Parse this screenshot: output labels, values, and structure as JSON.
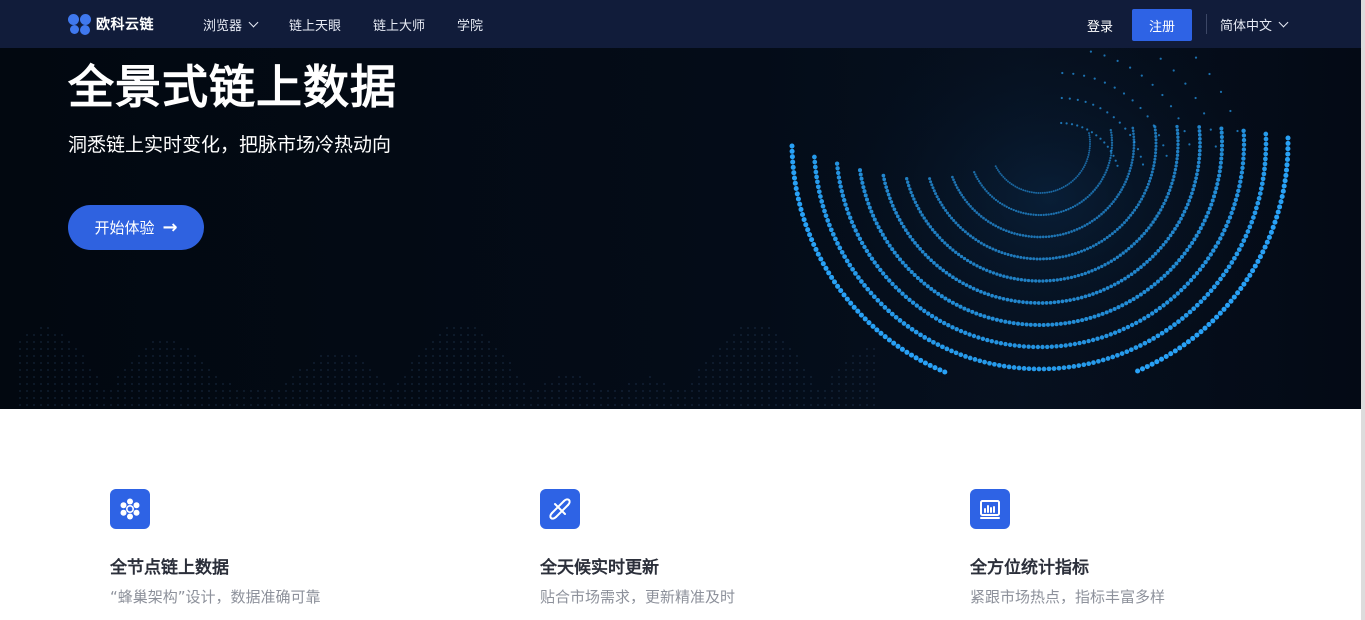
{
  "header": {
    "logo_text": "欧科云链",
    "nav": [
      {
        "label": "浏览器",
        "has_dropdown": true
      },
      {
        "label": "链上天眼"
      },
      {
        "label": "链上大师"
      },
      {
        "label": "学院"
      }
    ],
    "login_label": "登录",
    "register_label": "注册",
    "language_label": "简体中文"
  },
  "hero": {
    "title": "全景式链上数据",
    "subtitle": "洞悉链上实时变化，把脉市场冷热动向",
    "cta_label": "开始体验",
    "cta_icon": "arrow-right-icon"
  },
  "features": [
    {
      "icon": "honeycomb-icon",
      "title": "全节点链上数据",
      "description": "“蜂巢架构”设计，数据准确可靠"
    },
    {
      "icon": "realtime-sync-icon",
      "title": "全天候实时更新",
      "description": "贴合市场需求，更新精准及时"
    },
    {
      "icon": "chart-monitor-icon",
      "title": "全方位统计指标",
      "description": "紧跟市场热点，指标丰富多样"
    }
  ],
  "colors": {
    "nav_bg": "#111c3a",
    "accent": "#2e63e5",
    "hero_bg": "#030a14",
    "dot_glow": "#2aa8ff"
  }
}
